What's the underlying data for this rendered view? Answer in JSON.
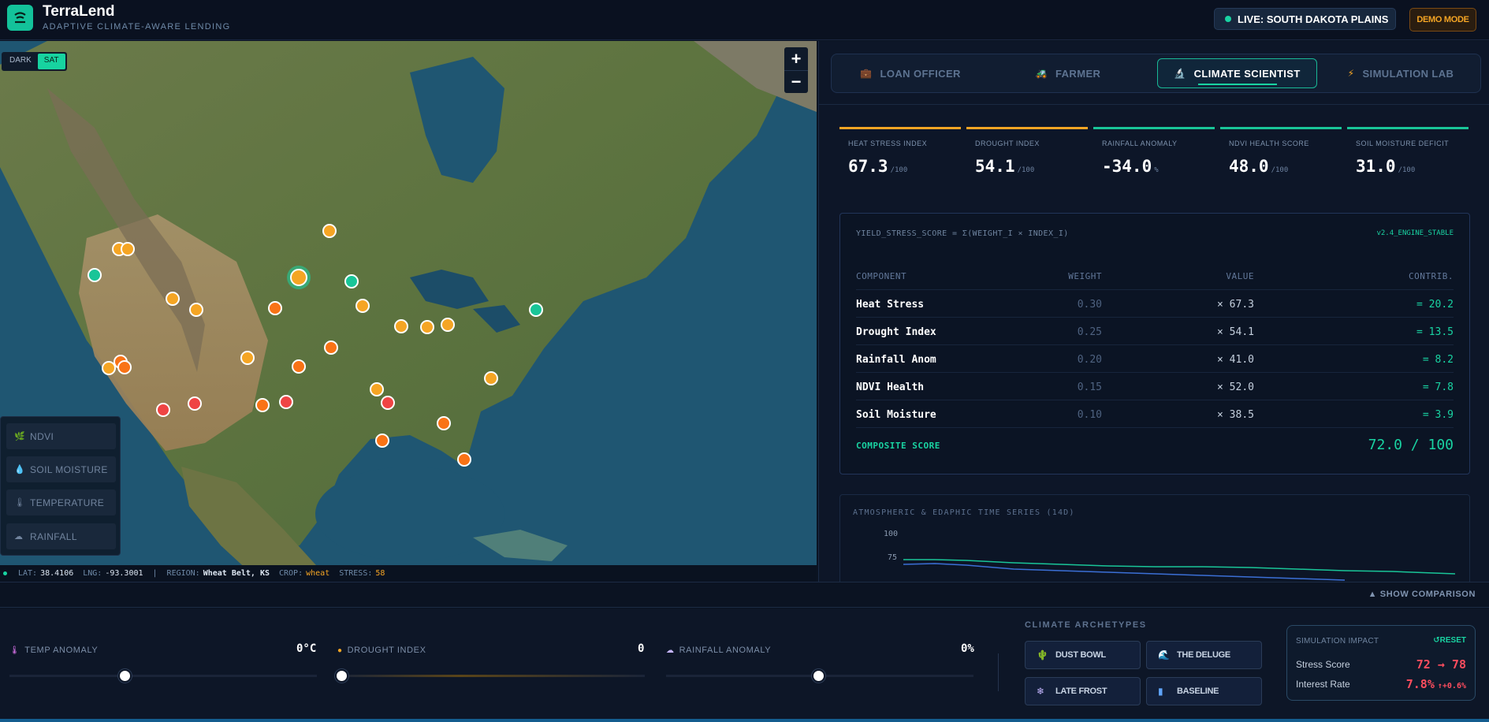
{
  "header": {
    "app_name": "TerraLend",
    "tagline": "ADAPTIVE CLIMATE-AWARE LENDING",
    "live_label": "LIVE: SOUTH DAKOTA PLAINS",
    "demo_label": "DEMO MODE"
  },
  "map": {
    "style_dark": "DARK",
    "style_sat": "SAT",
    "zoom_in": "+",
    "zoom_out": "−",
    "layers": [
      {
        "label": "NDVI",
        "icon": "leaf-icon"
      },
      {
        "label": "SOIL MOISTURE",
        "icon": "droplet-icon"
      },
      {
        "label": "TEMPERATURE",
        "icon": "thermometer-icon"
      },
      {
        "label": "RAINFALL",
        "icon": "cloud-rain-icon"
      }
    ],
    "status": {
      "lat_label": "LAT:",
      "lat": "38.4106",
      "lng_label": "LNG:",
      "lng": "-93.3001",
      "sep": "|",
      "region_label": "REGION:",
      "region": "Wheat Belt, KS",
      "crop_label": "CROP:",
      "crop": "wheat",
      "stress_label": "STRESS:",
      "stress": "58"
    },
    "marker_colors": {
      "low": "#19c598",
      "medium": "#f5a524",
      "high": "#f97316",
      "critical": "#ef4444"
    }
  },
  "tabs": [
    {
      "label": "LOAN OFFICER",
      "icon": "briefcase-icon"
    },
    {
      "label": "FARMER",
      "icon": "tractor-icon"
    },
    {
      "label": "CLIMATE SCIENTIST",
      "icon": "microscope-icon"
    },
    {
      "label": "SIMULATION LAB",
      "icon": "lightning-icon"
    }
  ],
  "metrics": [
    {
      "label": "HEAT STRESS INDEX",
      "value": "67.3",
      "unit": "/100"
    },
    {
      "label": "DROUGHT INDEX",
      "value": "54.1",
      "unit": "/100"
    },
    {
      "label": "RAINFALL ANOMALY",
      "value": "-34.0",
      "unit": "%"
    },
    {
      "label": "NDVI HEALTH SCORE",
      "value": "48.0",
      "unit": "/100"
    },
    {
      "label": "SOIL MOISTURE DEFICIT",
      "value": "31.0",
      "unit": "/100"
    }
  ],
  "formula": {
    "title": "YIELD_STRESS_SCORE = Σ(WEIGHT_I × INDEX_I)",
    "version": "v2.4_ENGINE_STABLE",
    "headers": {
      "component": "COMPONENT",
      "weight": "WEIGHT",
      "value": "VALUE",
      "contrib": "CONTRIB."
    },
    "rows": [
      {
        "component": "Heat Stress",
        "weight": "0.30",
        "value": "× 67.3",
        "contrib": "= 20.2"
      },
      {
        "component": "Drought Index",
        "weight": "0.25",
        "value": "× 54.1",
        "contrib": "= 13.5"
      },
      {
        "component": "Rainfall Anom",
        "weight": "0.20",
        "value": "× 41.0",
        "contrib": "= 8.2"
      },
      {
        "component": "NDVI Health",
        "weight": "0.15",
        "value": "× 52.0",
        "contrib": "= 7.8"
      },
      {
        "component": "Soil Moisture",
        "weight": "0.10",
        "value": "× 38.5",
        "contrib": "= 3.9"
      }
    ],
    "composite_label": "COMPOSITE SCORE",
    "composite_value": "72.0 / 100"
  },
  "timeseries": {
    "title": "ATMOSPHERIC & EDAPHIC TIME SERIES (14D)",
    "y_ticks": [
      "100",
      "75"
    ]
  },
  "bottom": {
    "comparison_label": "▲ SHOW COMPARISON",
    "sliders": [
      {
        "label": "TEMP ANOMALY",
        "value": "0°C",
        "icon": "thermometer-icon",
        "level": 0.0
      },
      {
        "label": "DROUGHT INDEX",
        "value": "0",
        "icon": "sun-icon",
        "level": 0.0
      },
      {
        "label": "RAINFALL ANOMALY",
        "value": "0%",
        "icon": "cloud-icon",
        "level": 0.5
      }
    ],
    "archetypes_title": "CLIMATE ARCHETYPES",
    "archetypes": [
      {
        "label": "DUST BOWL",
        "icon": "cactus-icon"
      },
      {
        "label": "THE DELUGE",
        "icon": "wave-icon"
      },
      {
        "label": "LATE FROST",
        "icon": "snowflake-icon"
      },
      {
        "label": "BASELINE",
        "icon": "bar-chart-icon"
      }
    ],
    "impact": {
      "title": "SIMULATION IMPACT",
      "reset": "↺RESET",
      "stress_label": "Stress Score",
      "stress_value": "72 → 78",
      "rate_label": "Interest Rate",
      "rate_value": "7.8%",
      "rate_delta": "↑+0.6%"
    }
  }
}
